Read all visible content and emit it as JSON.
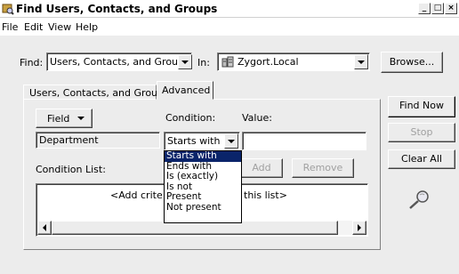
{
  "window": {
    "title": "Find Users, Contacts, and Groups",
    "buttons": [
      "_",
      "□",
      "×"
    ]
  },
  "menu": [
    "File",
    "Edit",
    "View",
    "Help"
  ],
  "find_row": {
    "find_label": "Find:",
    "find_value": "Users, Contacts, and Groups",
    "in_label": "In:",
    "in_value": "Zygort.Local",
    "browse_label": "Browse..."
  },
  "tabs": [
    "Users, Contacts, and Groups",
    "Advanced"
  ],
  "advanced": {
    "field_button": "Field",
    "condition_label": "Condition:",
    "value_label": "Value:",
    "field_value": "Department",
    "condition_value": "Starts with",
    "value_value": "",
    "condition_list_label": "Condition List:",
    "add_button": "Add",
    "remove_button": "Remove",
    "list_placeholder": "<Add criteria from above to this list>",
    "visible_left": "<Add crite",
    "visible_right": "this list>"
  },
  "condition_options": [
    "Starts with",
    "Ends with",
    "Is (exactly)",
    "Is not",
    "Present",
    "Not present"
  ],
  "side_buttons": {
    "find_now": "Find Now",
    "stop": "Stop",
    "clear_all": "Clear All"
  },
  "icons": {
    "app": "find-users-icon",
    "domain": "domain-icon",
    "search_anim": "magnifier-icon"
  }
}
